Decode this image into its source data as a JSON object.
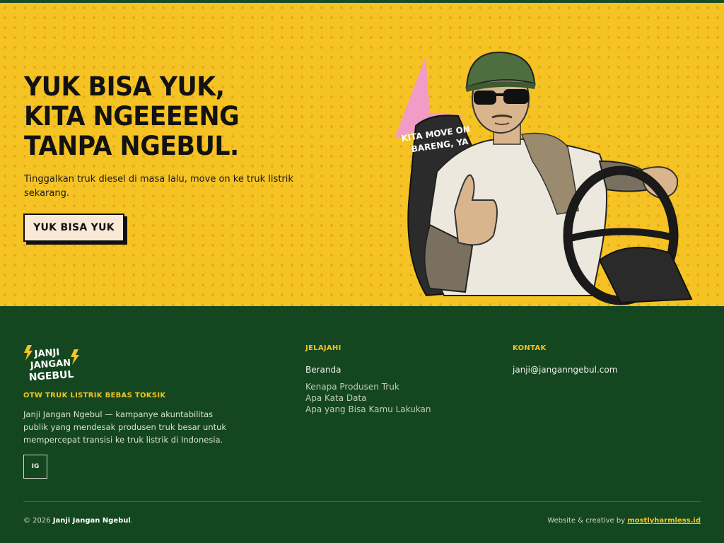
{
  "hero": {
    "title_lines": [
      "YUK BISA YUK,",
      "KITA NGEEEENG",
      "TANPA NGEBUL."
    ],
    "subtitle": "Tinggalkan truk diesel di masa lalu, move on ke truk listrik sekarang.",
    "cta_label": "YUK BISA YUK",
    "badge_lines": [
      "KITA MOVE ON",
      "BARENG, YA"
    ]
  },
  "footer": {
    "logo_lines": [
      "JANJI",
      "JANGAN",
      "NGEBUL"
    ],
    "tagline": "OTW TRUK LISTRIK BEBAS TOKSIK",
    "about": "Janji Jangan Ngebul — kampanye akuntabilitas publik yang mendesak produsen truk besar untuk mempercepat transisi ke truk listrik di Indonesia.",
    "social_label": "IG",
    "explore": {
      "heading": "JELAJAHI",
      "main_link": "Beranda",
      "links": [
        "Kenapa Produsen Truk",
        "Apa Kata Data",
        "Apa yang Bisa Kamu Lakukan"
      ]
    },
    "contact": {
      "heading": "KONTAK",
      "email": "janji@janganngebul.com"
    },
    "copyright_prefix": "© 2026 ",
    "copyright_name": "Janji Jangan Ngebul",
    "copyright_suffix": ".",
    "credit_prefix": "Website & creative by ",
    "credit_link": "mostlyharmless.id"
  },
  "colors": {
    "hero_bg": "#f5c324",
    "footer_bg": "#14471f",
    "accent": "#f5c324",
    "pink": "#f29bc7"
  }
}
